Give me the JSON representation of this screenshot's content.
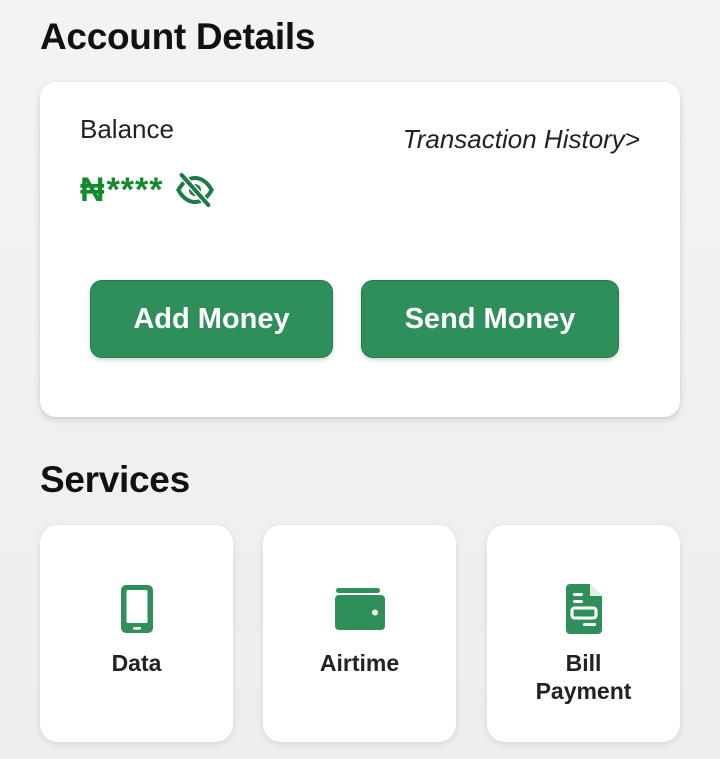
{
  "account": {
    "section_title": "Account Details",
    "balance_label": "Balance",
    "currency_symbol": "₦",
    "balance_masked": "****",
    "history_link": "Transaction History>",
    "add_money_label": "Add Money",
    "send_money_label": "Send Money"
  },
  "services": {
    "section_title": "Services",
    "items": [
      {
        "label": "Data",
        "icon": "phone-icon"
      },
      {
        "label": "Airtime",
        "icon": "wallet-icon"
      },
      {
        "label_line1": "Bill",
        "label_line2": "Payment",
        "icon": "bill-icon"
      }
    ]
  },
  "colors": {
    "accent_green": "#2f8f5a",
    "balance_green": "#138a2c",
    "background": "#efefef",
    "card": "#ffffff"
  }
}
